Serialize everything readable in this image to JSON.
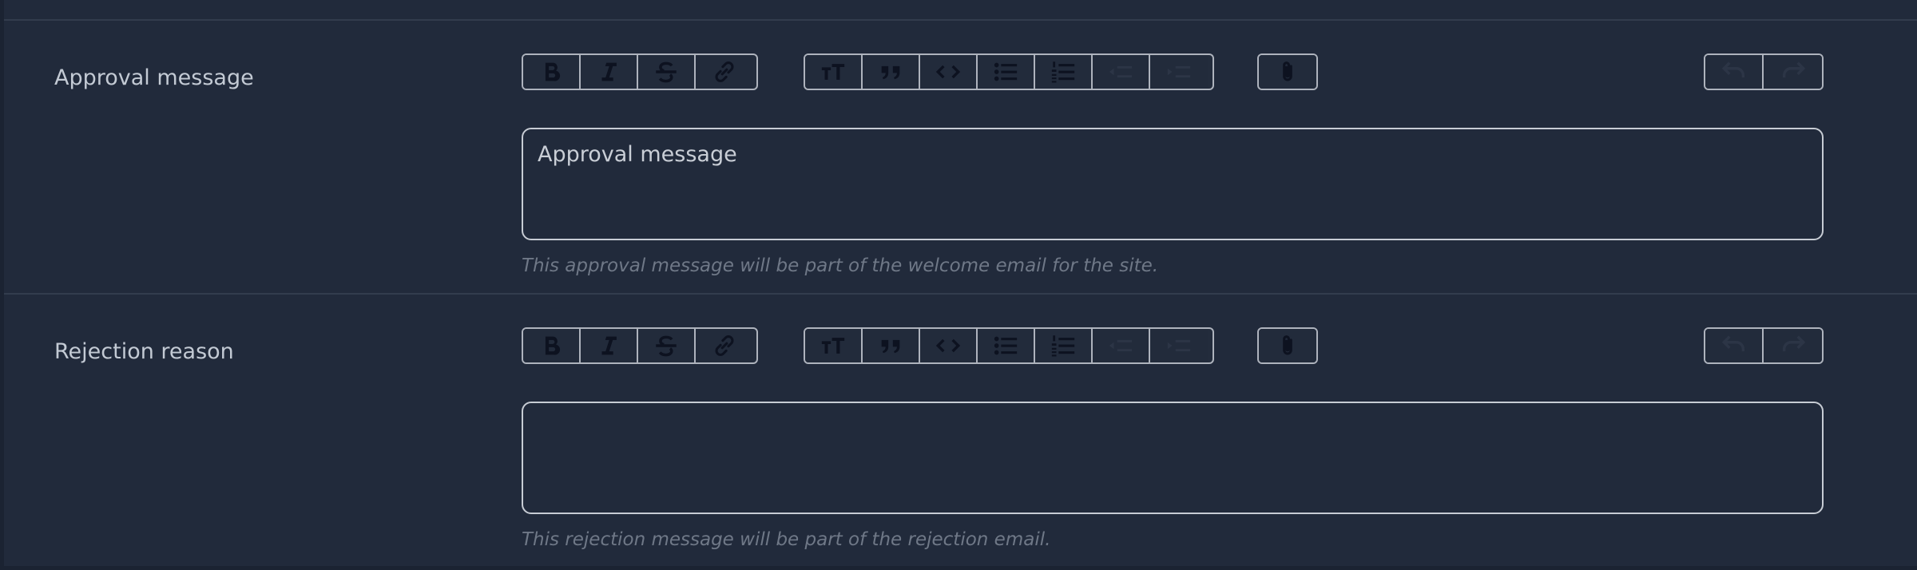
{
  "colors": {
    "background": "#212a3b",
    "border": "#c7ccd4",
    "label": "#c3cad4",
    "helper": "#6f7887"
  },
  "toolbar": {
    "text_icons": [
      "bold-icon",
      "italic-icon",
      "strikethrough-icon",
      "link-icon"
    ],
    "block_icons": [
      "heading-icon",
      "quote-icon",
      "code-icon",
      "bullet-list-icon",
      "numbered-list-icon",
      "decrease-indent-icon",
      "increase-indent-icon"
    ],
    "file_icons": [
      "attachment-icon"
    ],
    "history_icons": [
      "undo-icon",
      "redo-icon"
    ]
  },
  "approval": {
    "label": "Approval message",
    "content": "Approval message",
    "helper": "This approval message will be part of the welcome email for the site."
  },
  "rejection": {
    "label": "Rejection reason",
    "content": "",
    "helper": "This rejection message will be part of the rejection email."
  }
}
